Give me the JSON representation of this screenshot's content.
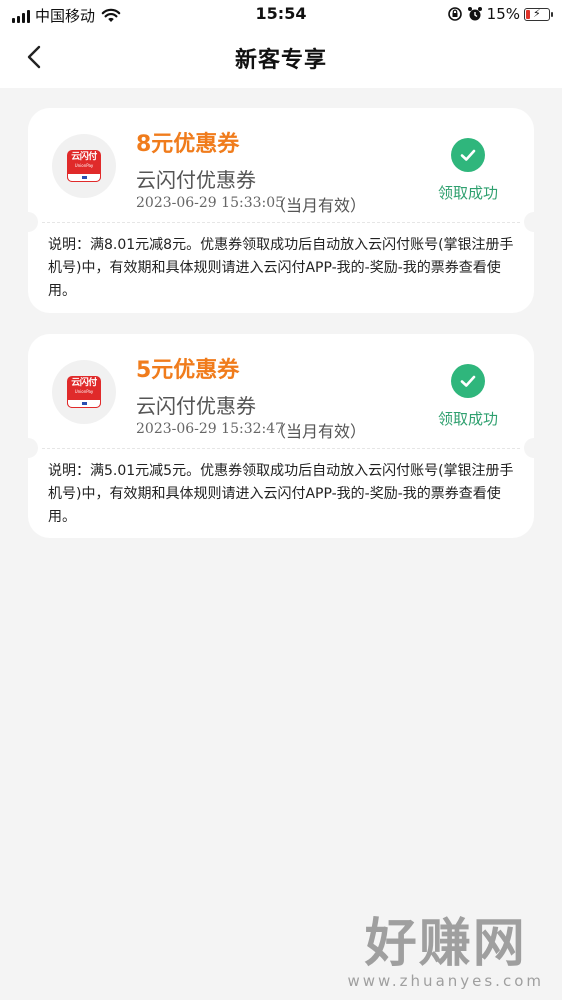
{
  "status_bar": {
    "carrier": "中国移动",
    "time": "15:54",
    "battery_percent": "15%",
    "battery_level": 0.15,
    "icons": [
      "signal-icon",
      "wifi-icon",
      "lock-rotation-icon",
      "alarm-icon",
      "battery-icon"
    ]
  },
  "nav": {
    "title": "新客专享",
    "back_icon": "chevron-left-icon"
  },
  "coupons": [
    {
      "amount": "8元优惠券",
      "type": "云闪付优惠券",
      "date": "2023-06-29 15:33:05",
      "validity": "（当月有效）",
      "status": "领取成功",
      "description": "说明：满8.01元减8元。优惠券领取成功后自动放入云闪付账号(掌银注册手机号)中，有效期和具体规则请进入云闪付APP-我的-奖励-我的票券查看使用。",
      "logo_text": "云闪付",
      "logo_sub": "UnionPay"
    },
    {
      "amount": "5元优惠券",
      "type": "云闪付优惠券",
      "date": "2023-06-29 15:32:47",
      "validity": "（当月有效）",
      "status": "领取成功",
      "description": "说明：满5.01元减5元。优惠券领取成功后自动放入云闪付账号(掌银注册手机号)中，有效期和具体规则请进入云闪付APP-我的-奖励-我的票券查看使用。",
      "logo_text": "云闪付",
      "logo_sub": "UnionPay"
    }
  ],
  "watermark": {
    "main": "好赚网",
    "sub": "www.zhuanyes.com"
  },
  "colors": {
    "accent_orange": "#f07c1c",
    "success_green": "#2fb67c",
    "brand_red": "#e02a2a",
    "page_bg": "#f4f4f4"
  }
}
